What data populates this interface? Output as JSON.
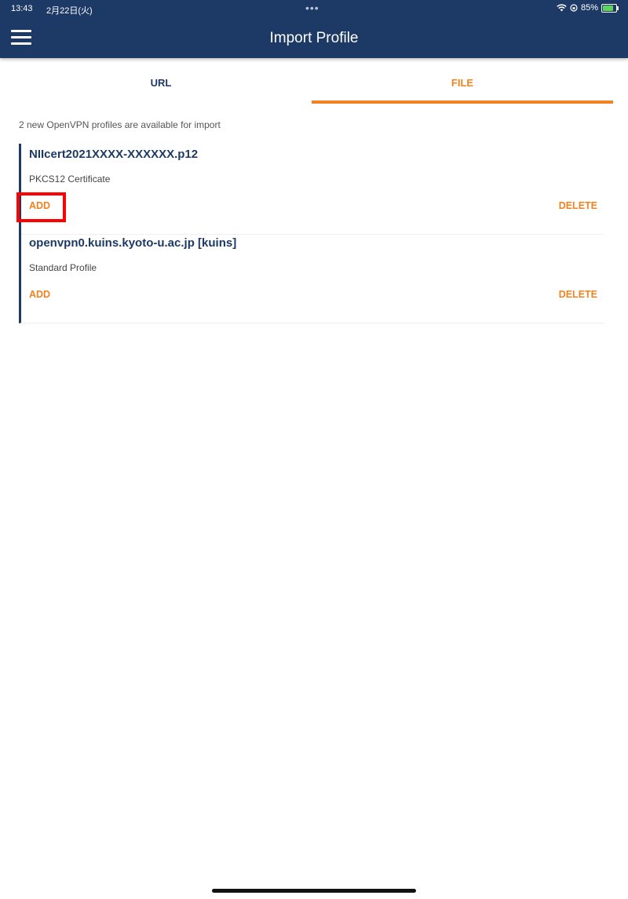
{
  "status": {
    "time": "13:43",
    "date": "2月22日(火)",
    "dots": "•••",
    "battery": "85%"
  },
  "header": {
    "title": "Import Profile"
  },
  "tabs": [
    {
      "label": "URL"
    },
    {
      "label": "FILE"
    }
  ],
  "info": "2 new OpenVPN profiles are available for import",
  "profiles": [
    {
      "name": "NIIcert2021XXXX-XXXXXX.p12",
      "type": "PKCS12 Certificate",
      "add": "ADD",
      "delete": "DELETE"
    },
    {
      "name": "openvpn0.kuins.kyoto-u.ac.jp [kuins]",
      "type": "Standard Profile",
      "add": "ADD",
      "delete": "DELETE"
    }
  ],
  "colors": {
    "primary": "#1d3a66",
    "accent": "#f0821f",
    "highlight": "#ff0000"
  }
}
